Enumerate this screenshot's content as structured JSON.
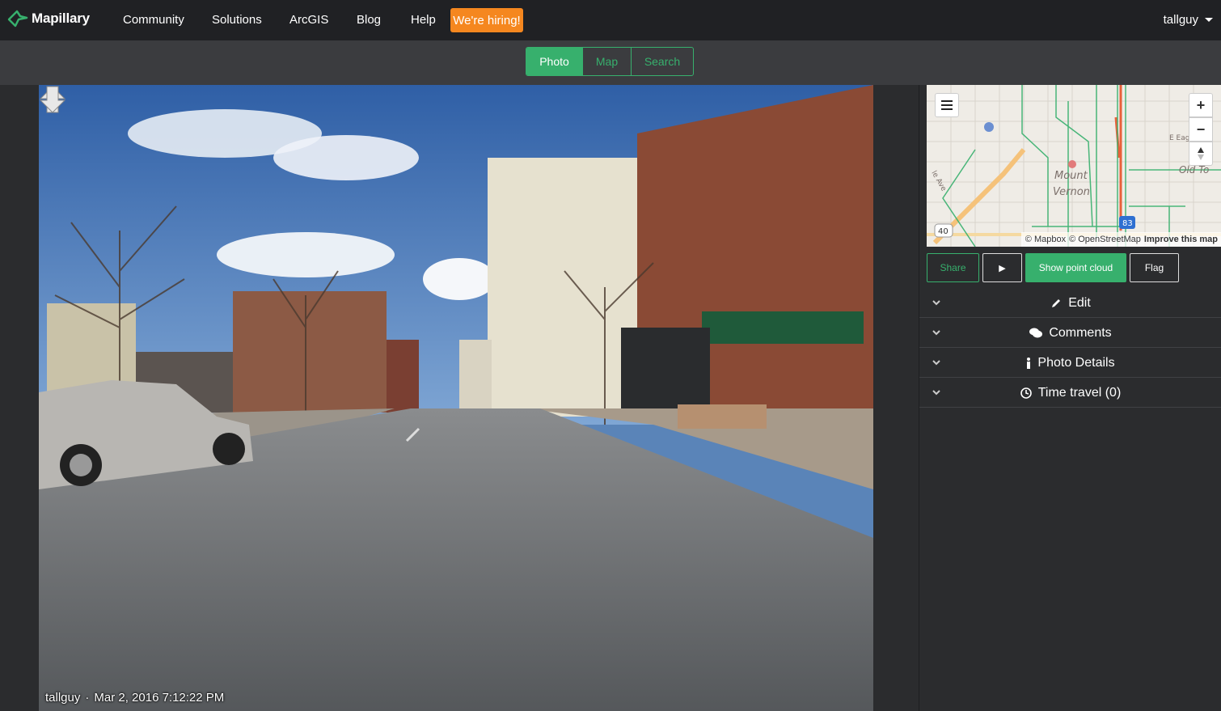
{
  "nav": {
    "logo": "Mapillary",
    "items": [
      "Community",
      "Solutions",
      "ArcGIS",
      "Blog",
      "Help"
    ],
    "hiring": "We're hiring!",
    "user": "tallguy"
  },
  "view_tabs": {
    "photo": "Photo",
    "map": "Map",
    "search": "Search",
    "active": "Photo"
  },
  "photo": {
    "username": "tallguy",
    "separator": "·",
    "timestamp": "Mar 2, 2016 7:12:22 PM"
  },
  "minimap": {
    "zoom_in": "+",
    "zoom_out": "−",
    "attribution": [
      "© Mapbox",
      "© OpenStreetMap"
    ],
    "improve": "Improve this map",
    "labels": {
      "neighborhood_1": "Mount",
      "neighborhood_2": "Vernon",
      "old_town": "Old To",
      "street": "E Eag",
      "ave": "le Ave",
      "route_40": "40",
      "interstate": "83"
    }
  },
  "actions": {
    "share": "Share",
    "play": "▶",
    "point_cloud": "Show point cloud",
    "flag": "Flag"
  },
  "panels": [
    {
      "label": "Edit",
      "icon": "pencil-icon"
    },
    {
      "label": "Comments",
      "icon": "comments-icon"
    },
    {
      "label": "Photo Details",
      "icon": "info-icon"
    },
    {
      "label": "Time travel (0)",
      "icon": "clock-icon"
    }
  ],
  "colors": {
    "accent": "#37b06d",
    "hiring": "#f5871f",
    "navbar": "#202124",
    "subbar": "#3b3c3f",
    "panel": "#2b2c2e"
  }
}
